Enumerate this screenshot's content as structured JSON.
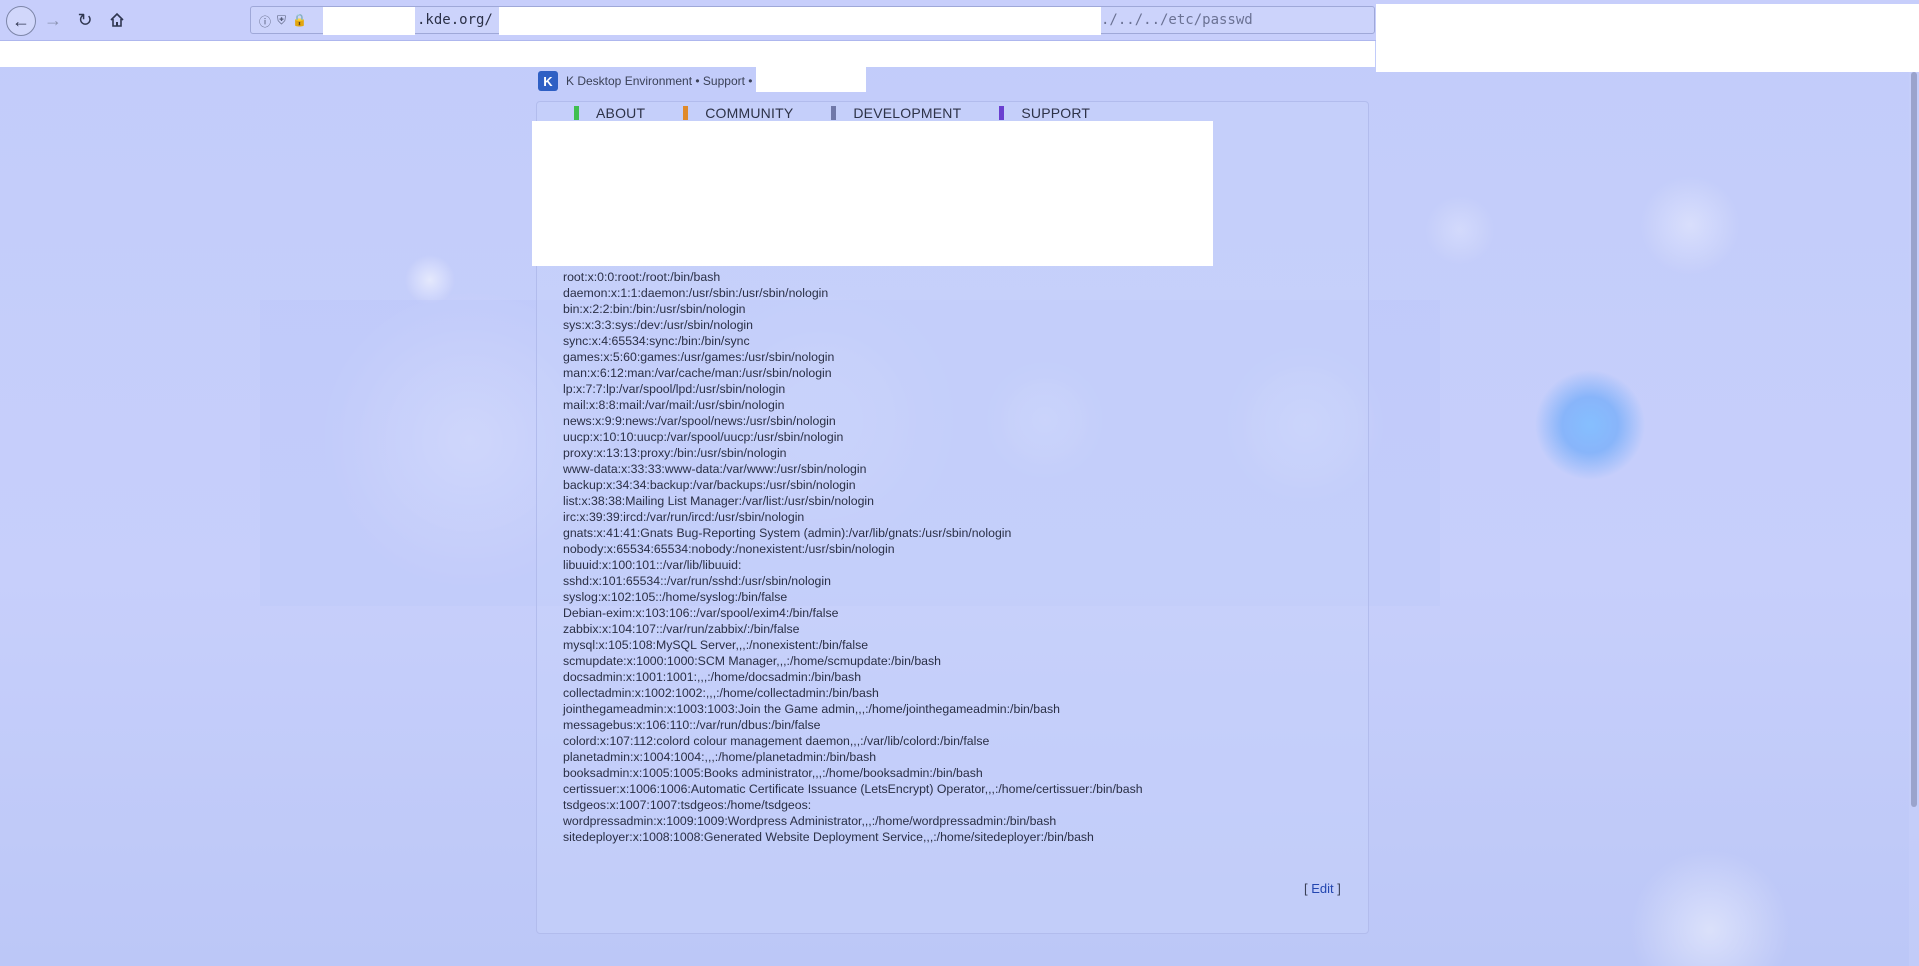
{
  "browser": {
    "back_icon": "arrow-left-icon",
    "forward_icon": "arrow-right-icon",
    "reload_icon": "reload-icon",
    "home_icon": "home-icon",
    "url_visible": ".kde.org/",
    "url_tail": "./../../etc/passwd",
    "site_info_icon": "info-icon",
    "tracking_icon": "shield-icon",
    "secure_icon": "lock-icon"
  },
  "site": {
    "logo_letter": "K",
    "title": "K Desktop Environment • Support •"
  },
  "menu": {
    "items": [
      {
        "label": "ABOUT",
        "color": "#3fbf4f"
      },
      {
        "label": "COMMUNITY",
        "color": "#e08a2a"
      },
      {
        "label": "DEVELOPMENT",
        "color": "#7078a8"
      },
      {
        "label": "SUPPORT",
        "color": "#6a3fd0"
      }
    ]
  },
  "passwd_lines": [
    "root:x:0:0:root:/root:/bin/bash",
    "daemon:x:1:1:daemon:/usr/sbin:/usr/sbin/nologin",
    "bin:x:2:2:bin:/bin:/usr/sbin/nologin",
    "sys:x:3:3:sys:/dev:/usr/sbin/nologin",
    "sync:x:4:65534:sync:/bin:/bin/sync",
    "games:x:5:60:games:/usr/games:/usr/sbin/nologin",
    "man:x:6:12:man:/var/cache/man:/usr/sbin/nologin",
    "lp:x:7:7:lp:/var/spool/lpd:/usr/sbin/nologin",
    "mail:x:8:8:mail:/var/mail:/usr/sbin/nologin",
    "news:x:9:9:news:/var/spool/news:/usr/sbin/nologin",
    "uucp:x:10:10:uucp:/var/spool/uucp:/usr/sbin/nologin",
    "proxy:x:13:13:proxy:/bin:/usr/sbin/nologin",
    "www-data:x:33:33:www-data:/var/www:/usr/sbin/nologin",
    "backup:x:34:34:backup:/var/backups:/usr/sbin/nologin",
    "list:x:38:38:Mailing List Manager:/var/list:/usr/sbin/nologin",
    "irc:x:39:39:ircd:/var/run/ircd:/usr/sbin/nologin",
    "gnats:x:41:41:Gnats Bug-Reporting System (admin):/var/lib/gnats:/usr/sbin/nologin",
    "nobody:x:65534:65534:nobody:/nonexistent:/usr/sbin/nologin",
    "libuuid:x:100:101::/var/lib/libuuid:",
    "sshd:x:101:65534::/var/run/sshd:/usr/sbin/nologin",
    "syslog:x:102:105::/home/syslog:/bin/false",
    "Debian-exim:x:103:106::/var/spool/exim4:/bin/false",
    "zabbix:x:104:107::/var/run/zabbix/:/bin/false",
    "mysql:x:105:108:MySQL Server,,,:/nonexistent:/bin/false",
    "scmupdate:x:1000:1000:SCM Manager,,,:/home/scmupdate:/bin/bash",
    "docsadmin:x:1001:1001:,,,:/home/docsadmin:/bin/bash",
    "collectadmin:x:1002:1002:,,,:/home/collectadmin:/bin/bash",
    "jointhegameadmin:x:1003:1003:Join the Game admin,,,:/home/jointhegameadmin:/bin/bash",
    "messagebus:x:106:110::/var/run/dbus:/bin/false",
    "colord:x:107:112:colord colour management daemon,,,:/var/lib/colord:/bin/false",
    "planetadmin:x:1004:1004:,,,:/home/planetadmin:/bin/bash",
    "booksadmin:x:1005:1005:Books administrator,,,:/home/booksadmin:/bin/bash",
    "certissuer:x:1006:1006:Automatic Certificate Issuance (LetsEncrypt) Operator,,,:/home/certissuer:/bin/bash",
    "tsdgeos:x:1007:1007:tsdgeos:/home/tsdgeos:",
    "wordpressadmin:x:1009:1009:Wordpress Administrator,,,:/home/wordpressadmin:/bin/bash",
    "sitedeployer:x:1008:1008:Generated Website Deployment Service,,,:/home/sitedeployer:/bin/bash"
  ],
  "edit": {
    "open": "[",
    "label": "Edit",
    "close": "]"
  }
}
